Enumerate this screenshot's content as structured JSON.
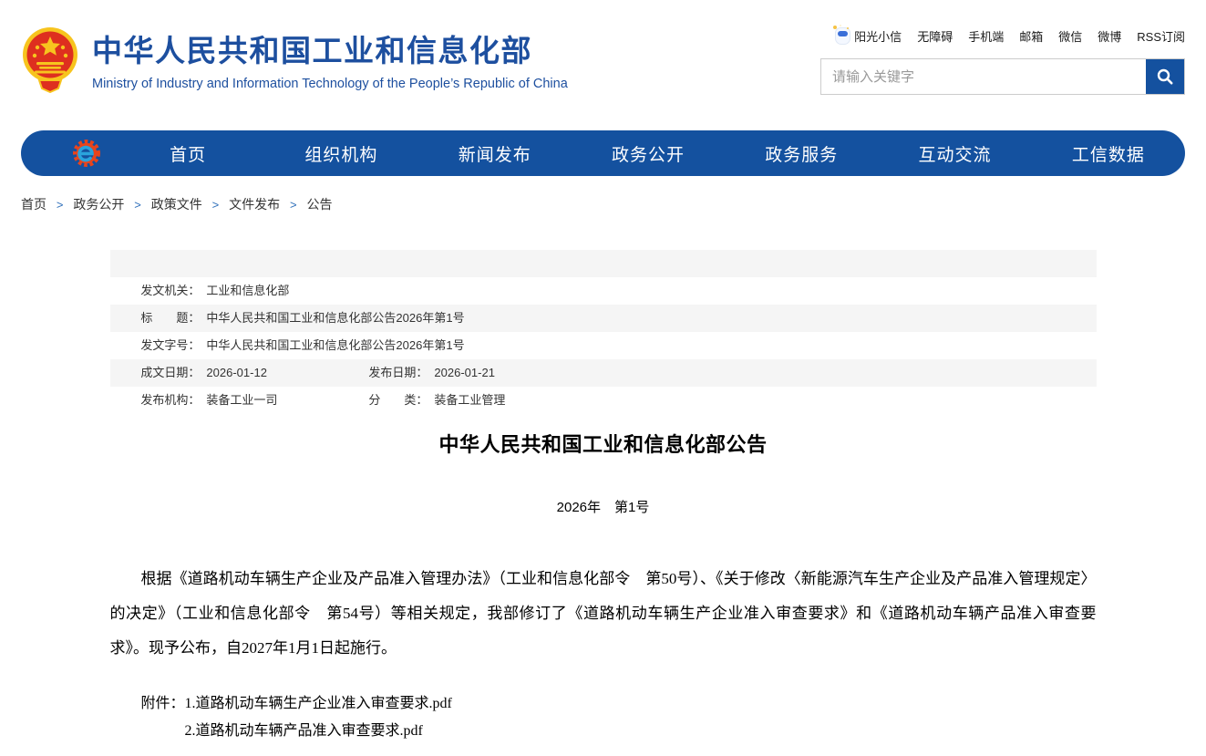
{
  "header": {
    "site_title": "中华人民共和国工业和信息化部",
    "site_subtitle": "Ministry of Industry and Information Technology of the People’s Republic of China",
    "top_links": [
      "阳光小信",
      "无障碍",
      "手机端",
      "邮箱",
      "微信",
      "微博",
      "RSS订阅"
    ],
    "search": {
      "placeholder": "请输入关键字"
    }
  },
  "nav": {
    "items": [
      "首页",
      "组织机构",
      "新闻发布",
      "政务公开",
      "政务服务",
      "互动交流",
      "工信数据"
    ]
  },
  "breadcrumb": {
    "separator": ">",
    "items": [
      "首页",
      "政务公开",
      "政策文件",
      "文件发布",
      "公告"
    ]
  },
  "meta_table": {
    "rows": [
      {
        "cells": [
          {
            "label": "发文机关：",
            "value": "工业和信息化部"
          }
        ]
      },
      {
        "cells": [
          {
            "label": "标　　题：",
            "value": "中华人民共和国工业和信息化部公告2026年第1号"
          }
        ]
      },
      {
        "cells": [
          {
            "label": "发文字号：",
            "value": "中华人民共和国工业和信息化部公告2026年第1号"
          }
        ]
      },
      {
        "cells": [
          {
            "label": "成文日期：",
            "value": "2026-01-12"
          },
          {
            "label": "发布日期：",
            "value": "2026-01-21"
          }
        ]
      },
      {
        "cells": [
          {
            "label": "发布机构：",
            "value": "装备工业一司"
          },
          {
            "label": "分　　类：",
            "value": "装备工业管理"
          }
        ]
      }
    ]
  },
  "article": {
    "title": "中华人民共和国工业和信息化部公告",
    "issue_line": "2026年　第1号",
    "paragraph": "根据《道路机动车辆生产企业及产品准入管理办法》（工业和信息化部令　第50号）、《关于修改〈新能源汽车生产企业及产品准入管理规定〉的决定》（工业和信息化部令　第54号）等相关规定，我部修订了《道路机动车辆生产企业准入审查要求》和《道路机动车辆产品准入审查要求》。现予公布，自2027年1月1日起施行。",
    "attachments": {
      "label": "附件：",
      "items": [
        "1.道路机动车辆生产企业准入审查要求.pdf",
        "2.道路机动车辆产品准入审查要求.pdf"
      ]
    }
  },
  "colors": {
    "brand_blue": "#1d4f9f",
    "nav_blue": "#14519f",
    "row_gray": "#f5f5f5",
    "crumb_separator_blue": "#2e6fba",
    "emblem_red": "#de2f1f",
    "emblem_gold": "#f7c41e"
  }
}
